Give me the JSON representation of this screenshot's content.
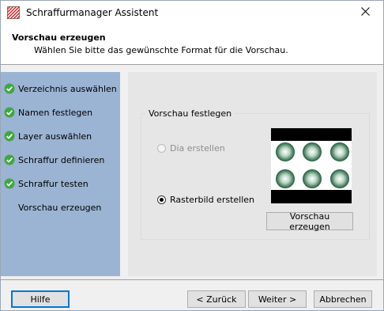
{
  "window": {
    "title": "Schraffurmanager Assistent"
  },
  "header": {
    "title": "Vorschau erzeugen",
    "subtitle": "Wählen Sie bitte das gewünschte Format für die Vorschau."
  },
  "sidebar": {
    "steps": [
      {
        "label": "Verzeichnis auswählen",
        "done": true
      },
      {
        "label": "Namen festlegen",
        "done": true
      },
      {
        "label": "Layer auswählen",
        "done": true
      },
      {
        "label": "Schraffur definieren",
        "done": true
      },
      {
        "label": "Schraffur testen",
        "done": true
      },
      {
        "label": "Vorschau erzeugen",
        "done": false
      }
    ]
  },
  "group": {
    "legend": "Vorschau festlegen",
    "option_dia": "Dia erstellen",
    "option_raster": "Rasterbild erstellen",
    "selected": "raster",
    "dia_enabled": false,
    "preview_button": "Vorschau erzeugen"
  },
  "buttons": {
    "help": "Hilfe",
    "back": "< Zurück",
    "next": "Weiter >",
    "cancel": "Abbrechen"
  },
  "colors": {
    "sidebar": "#9bb4d4",
    "check": "#3ea83e",
    "accent": "#0078d7"
  },
  "icons": {
    "app": "hatch-manager-icon",
    "close": "close-icon",
    "step_done": "check-circle-icon"
  }
}
